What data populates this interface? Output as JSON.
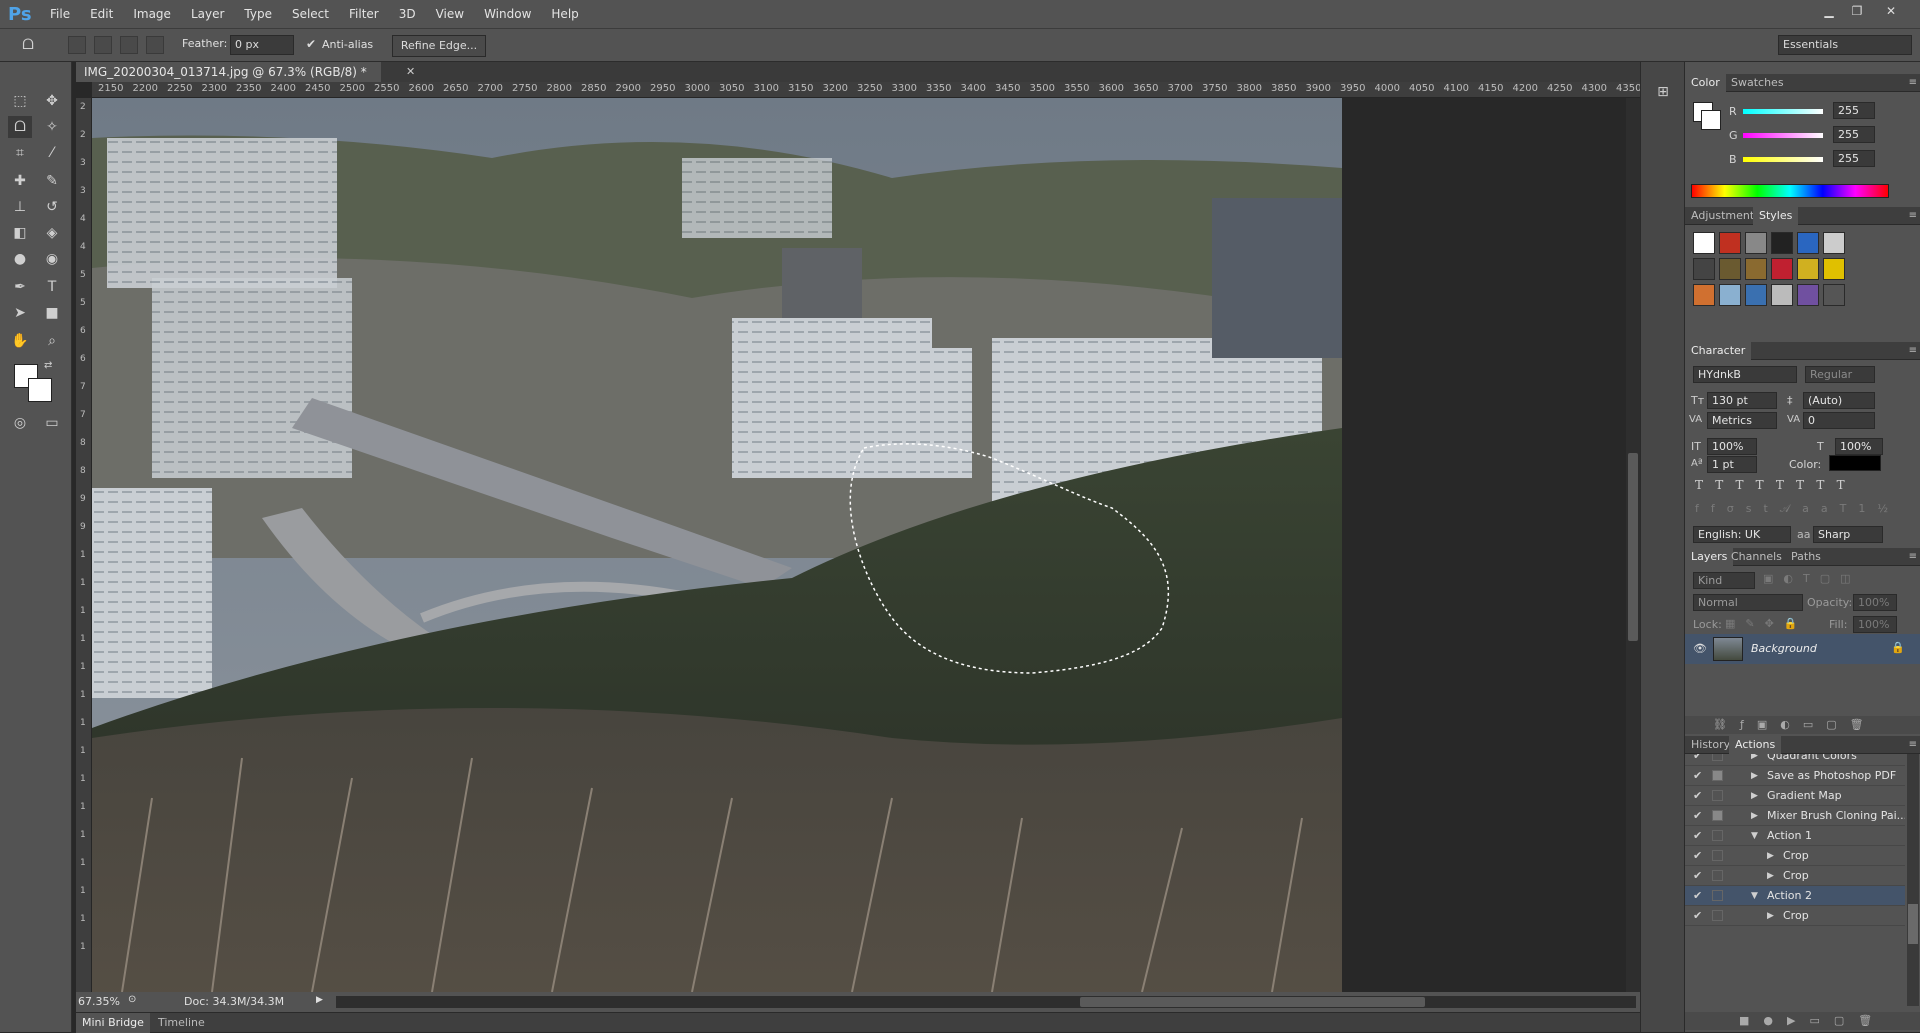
{
  "app": {
    "logo": "Ps",
    "menu": [
      "File",
      "Edit",
      "Image",
      "Layer",
      "Type",
      "Select",
      "Filter",
      "3D",
      "View",
      "Window",
      "Help"
    ],
    "workspace": "Essentials"
  },
  "options": {
    "feather_label": "Feather:",
    "feather_value": "0 px",
    "antialias_label": "Anti-alias",
    "antialias_checked": true,
    "refine_edge": "Refine Edge..."
  },
  "document": {
    "tab_title": "IMG_20200304_013714.jpg @ 67.3% (RGB/8) *",
    "zoom": "67.35%",
    "doc_size": "Doc: 34.3M/34.3M"
  },
  "ruler": {
    "ticks": [
      "2150",
      "2200",
      "2250",
      "2300",
      "2350",
      "2400",
      "2450",
      "2500",
      "2550",
      "2600",
      "2650",
      "2700",
      "2750",
      "2800",
      "2850",
      "2900",
      "2950",
      "3000",
      "3050",
      "3100",
      "3150",
      "3200",
      "3250",
      "3300",
      "3350",
      "3400",
      "3450",
      "3500",
      "3550",
      "3600",
      "3650",
      "3700",
      "3750",
      "3800",
      "3850",
      "3900",
      "3950",
      "4000",
      "4050",
      "4100",
      "4150",
      "4200",
      "4250",
      "4300",
      "4350"
    ],
    "left": [
      "2",
      "2",
      "3",
      "3",
      "4",
      "4",
      "5",
      "5",
      "6",
      "6",
      "7",
      "7",
      "8",
      "8",
      "9",
      "9",
      "1",
      "1",
      "1",
      "1",
      "1",
      "1",
      "1",
      "1",
      "1",
      "1",
      "1",
      "1",
      "1",
      "1",
      "1"
    ]
  },
  "bottom_tabs": {
    "mini_bridge": "Mini Bridge",
    "timeline": "Timeline"
  },
  "color_panel": {
    "tabs": [
      "Color",
      "Swatches"
    ],
    "r_label": "R",
    "g_label": "G",
    "b_label": "B",
    "r": "255",
    "g": "255",
    "b": "255"
  },
  "styles_panel": {
    "tabs": [
      "Adjustments",
      "Styles"
    ]
  },
  "character": {
    "title": "Character",
    "font": "HYdnkB",
    "style": "Regular",
    "size": "130 pt",
    "leading": "(Auto)",
    "kerning": "Metrics",
    "tracking": "0",
    "vscale": "100%",
    "hscale": "100%",
    "baseline": "1 pt",
    "color_label": "Color:",
    "language": "English: UK",
    "antialias": "Sharp",
    "aa_label": "aa"
  },
  "layers": {
    "tabs": [
      "Layers",
      "Channels",
      "Paths"
    ],
    "kind": "Kind",
    "blend": "Normal",
    "opacity_label": "Opacity:",
    "opacity": "100%",
    "lock_label": "Lock:",
    "fill_label": "Fill:",
    "fill": "100%",
    "items": [
      {
        "name": "Background"
      }
    ]
  },
  "actions": {
    "tabs": [
      "History",
      "Actions"
    ],
    "items": [
      {
        "name": "Quadrant Colors",
        "level": 1,
        "expanded": false,
        "dialog": false
      },
      {
        "name": "Save as Photoshop PDF",
        "level": 1,
        "expanded": false,
        "dialog": true
      },
      {
        "name": "Gradient Map",
        "level": 1,
        "expanded": false,
        "dialog": false
      },
      {
        "name": "Mixer Brush Cloning Pai...",
        "level": 1,
        "expanded": false,
        "dialog": true
      },
      {
        "name": "Action 1",
        "level": 1,
        "expanded": true,
        "dialog": false
      },
      {
        "name": "Crop",
        "level": 2,
        "expanded": false,
        "dialog": false
      },
      {
        "name": "Crop",
        "level": 2,
        "expanded": false,
        "dialog": false
      },
      {
        "name": "Action 2",
        "level": 1,
        "expanded": true,
        "dialog": false,
        "selected": true
      },
      {
        "name": "Crop",
        "level": 2,
        "expanded": false,
        "dialog": false
      }
    ]
  },
  "colors": {
    "accent": "#4fa3e8",
    "panel": "#535353",
    "dark": "#282828",
    "selected_row": "#44546a"
  }
}
